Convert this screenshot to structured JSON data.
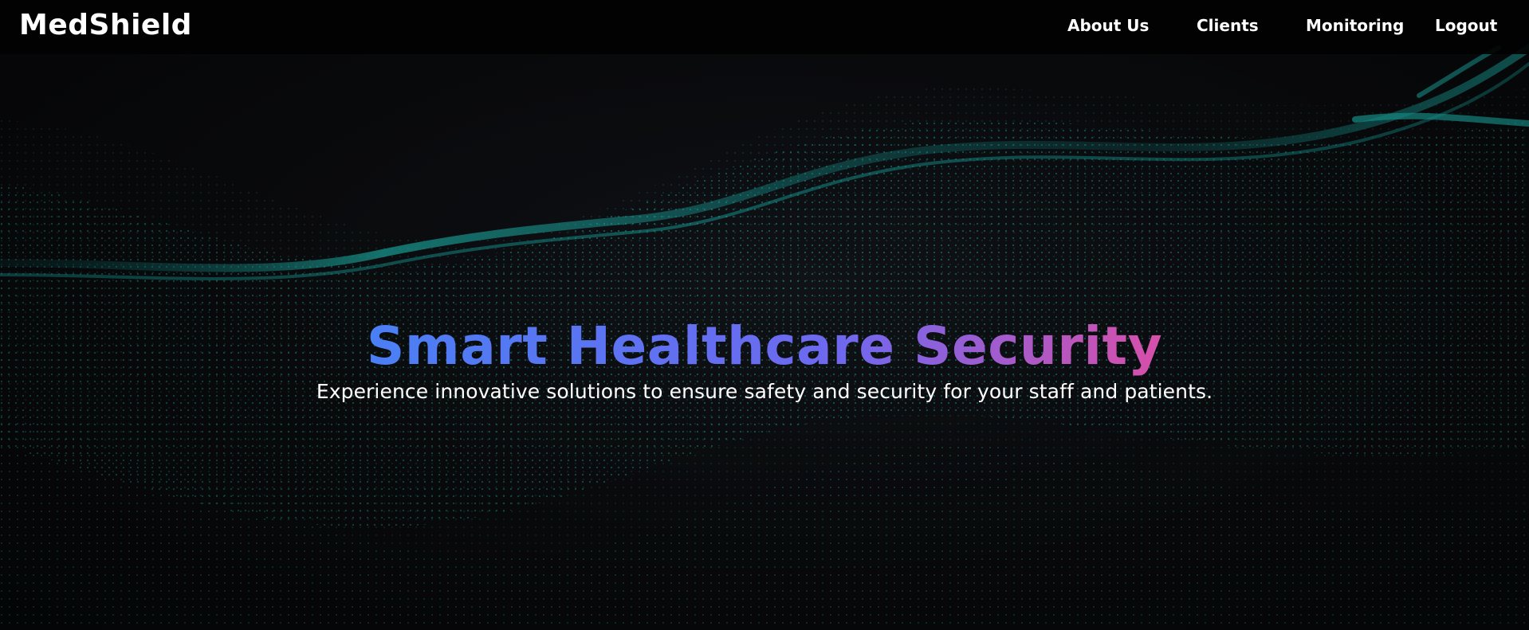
{
  "header": {
    "brand": "MedShield",
    "nav": [
      {
        "label": "About Us"
      },
      {
        "label": "Clients"
      },
      {
        "label": "Monitoring"
      },
      {
        "label": "Logout"
      }
    ]
  },
  "hero": {
    "title": "Smart Healthcare Security",
    "subtitle": "Experience innovative solutions to ensure safety and security for your staff and patients.",
    "title_gradient": [
      "#4a7ff5",
      "#6f68ee",
      "#d84fa9"
    ]
  },
  "background": {
    "style": "teal particle wave on black",
    "wave_color": "#1fb8b0",
    "base_color": "#0a0a0c"
  },
  "icons": {
    "background_art": "particle-wave-graphic"
  }
}
